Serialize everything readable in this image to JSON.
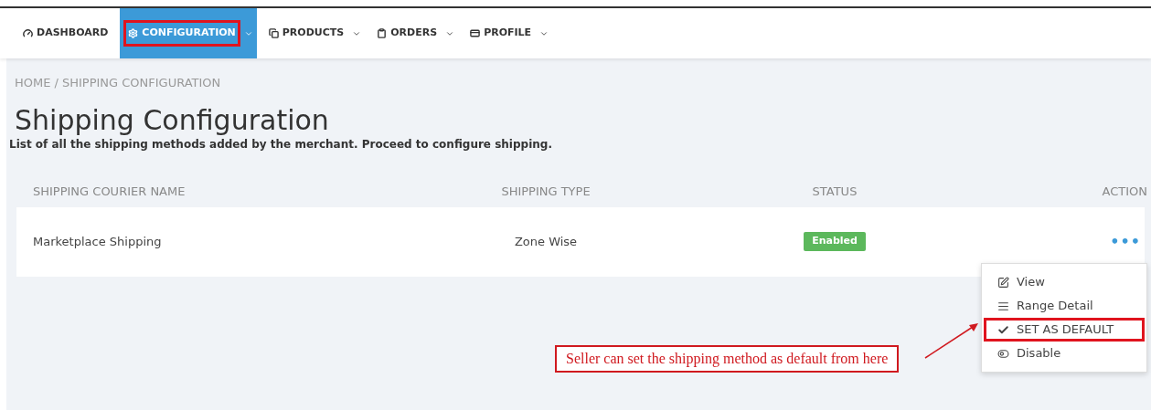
{
  "nav": [
    {
      "label": "DASHBOARD",
      "dropdown": false,
      "selected": false,
      "annotated": false
    },
    {
      "label": "CONFIGURATION",
      "dropdown": true,
      "selected": true,
      "annotated": true
    },
    {
      "label": "PRODUCTS",
      "dropdown": true,
      "selected": false,
      "annotated": false
    },
    {
      "label": "ORDERS",
      "dropdown": true,
      "selected": false,
      "annotated": false
    },
    {
      "label": "PROFILE",
      "dropdown": true,
      "selected": false,
      "annotated": false
    }
  ],
  "breadcrumb": [
    {
      "label": "HOME"
    },
    {
      "label": "/ SHIPPING CONFIGURATION"
    }
  ],
  "title": "Shipping Configuration",
  "subtitle": "List of all the shipping methods added by the merchant. Proceed to configure shipping.",
  "table": {
    "columns": [
      "SHIPPING COURIER NAME",
      "SHIPPING TYPE",
      "STATUS",
      "ACTION"
    ],
    "rows": [
      {
        "name": "Marketplace Shipping",
        "type": "Zone Wise",
        "status": "Enabled",
        "action": "•••"
      }
    ]
  },
  "action_menu": {
    "items": [
      {
        "label": "View",
        "annotated": false
      },
      {
        "label": "Range Detail",
        "annotated": false
      },
      {
        "label": "SET AS DEFAULT",
        "annotated": true
      },
      {
        "label": "Disable",
        "annotated": false
      }
    ]
  },
  "annotation": {
    "text": "Seller can set the shipping method as default from here"
  }
}
